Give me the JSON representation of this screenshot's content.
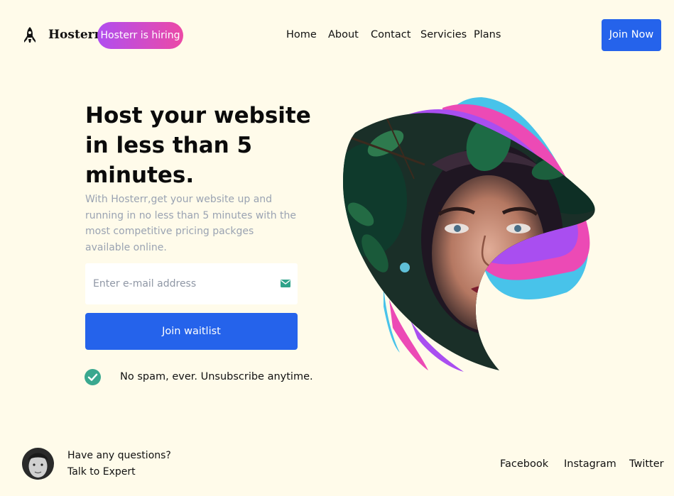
{
  "header": {
    "brand": "Hosterr",
    "hiring_badge": "Hosterr is hiring",
    "nav": [
      "Home",
      "About",
      "Contact",
      "Servicies",
      "Plans"
    ],
    "cta": "Join Now",
    "logo_icon": "rocket-icon"
  },
  "hero": {
    "title": "Host your website in less than 5 minutes.",
    "description": "With Hosterr,get your website up and running in no less than 5 minutes with the most competitive pricing packges available online.",
    "email_placeholder": "Enter e-mail address",
    "email_icon": "mail-icon",
    "waitlist_button": "Join waitlist",
    "no_spam": "No spam, ever. Unsubscribe anytime.",
    "check_icon": "check-circle-icon"
  },
  "footer": {
    "question": "Have any questions?",
    "expert": "Talk to Expert",
    "social": [
      "Facebook",
      "Instagram",
      "Twitter"
    ]
  },
  "colors": {
    "background": "#fffbea",
    "primary": "#2563eb",
    "badge_gradient_start": "#b04ef0",
    "badge_gradient_end": "#ec4aa6",
    "accent_blue": "#48c3ea",
    "accent_pink": "#ec4ab5",
    "accent_purple": "#a94ef0",
    "check": "#3aa88f",
    "muted_text": "#9aa3b2"
  }
}
